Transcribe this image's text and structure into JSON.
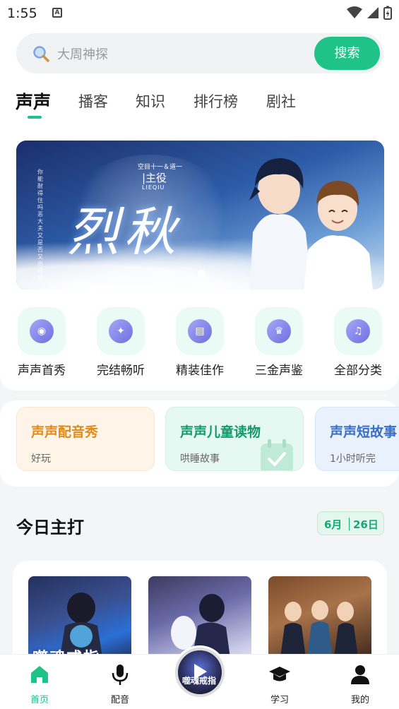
{
  "status": {
    "time": "1:55",
    "notif": "A"
  },
  "search": {
    "placeholder": "大周神探",
    "button_label": "搜索"
  },
  "tabs": [
    {
      "label": "声声",
      "active": true
    },
    {
      "label": "播客"
    },
    {
      "label": "知识"
    },
    {
      "label": "排行榜"
    },
    {
      "label": "剧社"
    }
  ],
  "banner": {
    "title": "烈秋",
    "role_line": "空目十一＆道一",
    "role_main": "|主役",
    "role_sub": "LIEQIU",
    "side_text": "你能耐得住吗恶大夫又是否又出问题",
    "page_indicator": "1"
  },
  "quick_entries": [
    {
      "label": "声声首秀",
      "icon": "speaker-icon",
      "glyph": "◉"
    },
    {
      "label": "完结畅听",
      "icon": "planet-icon",
      "glyph": "✦"
    },
    {
      "label": "精装佳作",
      "icon": "book-icon",
      "glyph": "▤"
    },
    {
      "label": "三金声鉴",
      "icon": "trophy-icon",
      "glyph": "♛"
    },
    {
      "label": "全部分类",
      "icon": "folder-icon",
      "glyph": "♫"
    }
  ],
  "promos": [
    {
      "title": "声声配音秀",
      "subtitle": "好玩",
      "title_color": "#e08a1a",
      "bg": "#fff4e8"
    },
    {
      "title": "声声儿童读物",
      "subtitle": "哄睡故事",
      "title_color": "#139a6c",
      "bg": "#e5f8f1"
    },
    {
      "title": "声声短故事",
      "subtitle": "1小时听完",
      "title_color": "#3a6fc4",
      "bg": "#e8f1fc"
    }
  ],
  "today": {
    "title": "今日主打",
    "month": "6月",
    "day": "26日",
    "covers": [
      {
        "text": "噬魂戒指"
      },
      {
        "text": ""
      },
      {
        "text": ""
      }
    ]
  },
  "nav": {
    "items": [
      {
        "label": "首页",
        "icon": "home-icon",
        "active": true
      },
      {
        "label": "配音",
        "icon": "microphone-icon"
      },
      {
        "label": "学习",
        "icon": "graduation-cap-icon"
      },
      {
        "label": "我的",
        "icon": "profile-icon"
      }
    ],
    "player_text": "噬魂戒指"
  },
  "colors": {
    "accent": "#1fc38a"
  }
}
